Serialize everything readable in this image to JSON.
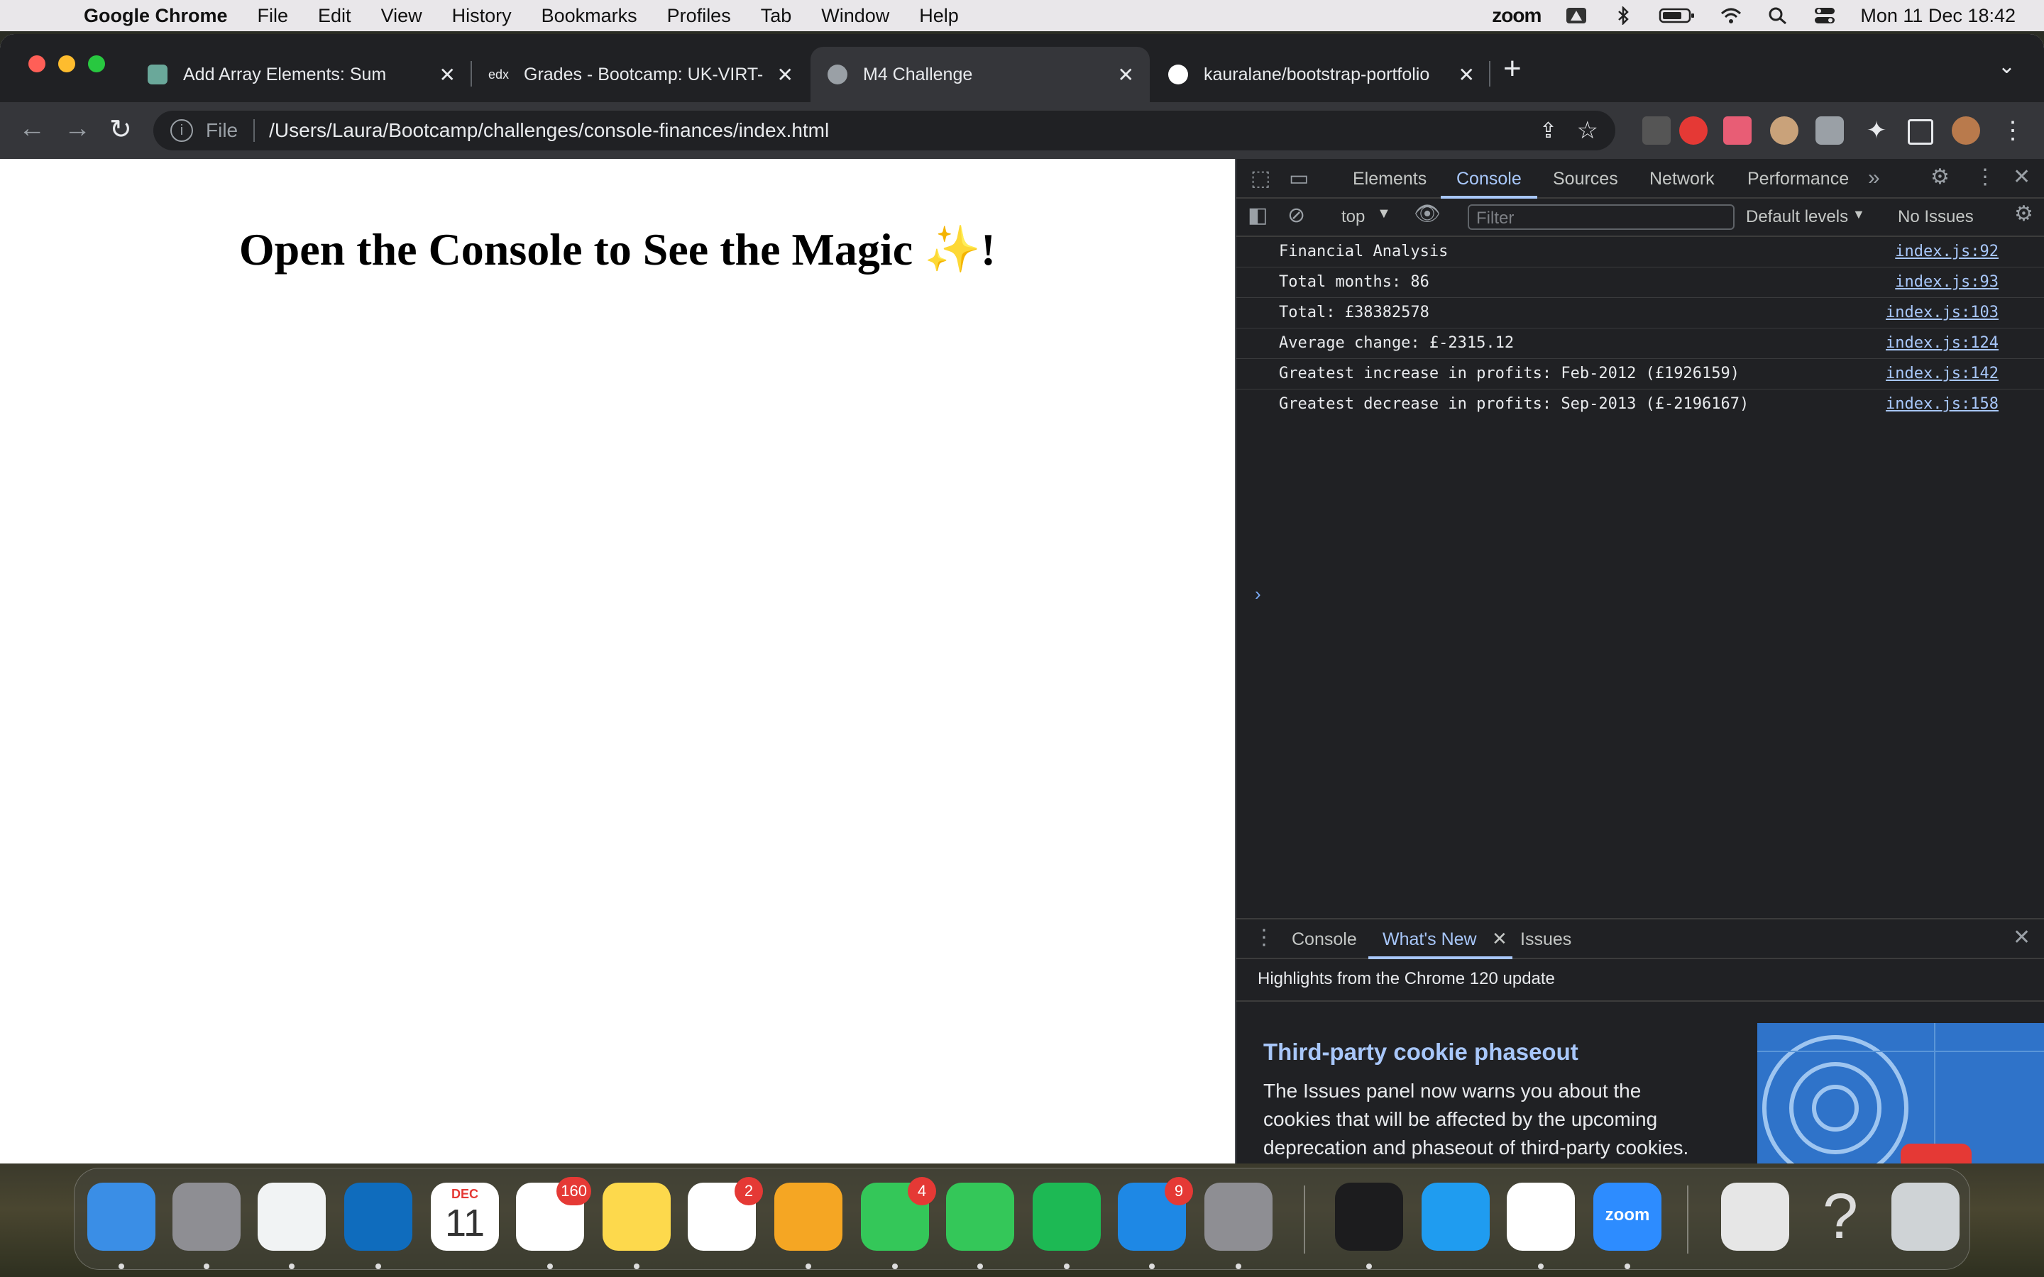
{
  "menubar": {
    "app_name": "Google Chrome",
    "items": [
      "File",
      "Edit",
      "View",
      "History",
      "Bookmarks",
      "Profiles",
      "Tab",
      "Window",
      "Help"
    ],
    "status": {
      "zoom": "zoom",
      "datetime": "Mon 11 Dec  18:42"
    }
  },
  "browser": {
    "tabs": [
      {
        "title": "Add Array Elements: Sum",
        "favicon_color": "#6aa89a",
        "active": false
      },
      {
        "title": "Grades - Bootcamp: UK-VIRT-",
        "favicon_color": "#3c3c3c",
        "active": false
      },
      {
        "title": "M4 Challenge",
        "favicon_color": "#9aa0a6",
        "active": true
      },
      {
        "title": "kauralane/bootstrap-portfolio",
        "favicon_color": "#ffffff",
        "active": false
      }
    ],
    "address": {
      "scheme_label": "File",
      "url": "/Users/Laura/Bootcamp/challenges/console-finances/index.html"
    }
  },
  "page": {
    "heading": "Open the Console to See the Magic ",
    "sparkle": "✨",
    "exclaim": "!"
  },
  "devtools": {
    "tabs": [
      "Elements",
      "Console",
      "Sources",
      "Network",
      "Performance"
    ],
    "active_tab": "Console",
    "toolbar": {
      "context": "top",
      "filter_placeholder": "Filter",
      "levels": "Default levels",
      "issues": "No Issues"
    },
    "logs": [
      {
        "message": "Financial Analysis",
        "source": "index.js:92"
      },
      {
        "message": "Total months: 86",
        "source": "index.js:93"
      },
      {
        "message": "Total: £38382578",
        "source": "index.js:103"
      },
      {
        "message": "Average change: £-2315.12",
        "source": "index.js:124"
      },
      {
        "message": "Greatest increase in profits: Feb-2012 (£1926159)",
        "source": "index.js:142"
      },
      {
        "message": "Greatest decrease in profits: Sep-2013 (£-2196167)",
        "source": "index.js:158"
      }
    ],
    "drawer": {
      "tabs": [
        "Console",
        "What's New",
        "Issues"
      ],
      "active_tab": "What's New",
      "highlight": "Highlights from the Chrome 120 update",
      "feature_title": "Third-party cookie phaseout",
      "feature_body": "The Issues panel now warns you about the cookies that will be affected by the upcoming deprecation and phaseout of third-party cookies."
    }
  },
  "dock": {
    "apps": [
      {
        "name": "Finder",
        "color": "#3a8ee6"
      },
      {
        "name": "Launchpad",
        "color": "#8e8e93"
      },
      {
        "name": "Google Chrome",
        "color": "#f1f3f4"
      },
      {
        "name": "Outlook",
        "color": "#0f6cbd"
      },
      {
        "name": "Calendar",
        "color": "#ffffff",
        "label_month": "DEC",
        "label_day": "11"
      },
      {
        "name": "Reminders",
        "color": "#ffffff",
        "badge": "160"
      },
      {
        "name": "Notes",
        "color": "#fdd94c"
      },
      {
        "name": "Photos",
        "color": "#ffffff",
        "badge": "2"
      },
      {
        "name": "Pages",
        "color": "#f5a623"
      },
      {
        "name": "Messages",
        "color": "#34c759",
        "badge": "4"
      },
      {
        "name": "FaceTime",
        "color": "#34c759"
      },
      {
        "name": "Spotify",
        "color": "#1db954"
      },
      {
        "name": "App Store",
        "color": "#1e88e5",
        "badge": "9"
      },
      {
        "name": "System Settings",
        "color": "#8e8e93"
      },
      {
        "name": "Terminal",
        "color": "#1c1c1e"
      },
      {
        "name": "VS Code",
        "color": "#1f9cf0"
      },
      {
        "name": "Slack",
        "color": "#ffffff"
      },
      {
        "name": "Zoom",
        "color": "#2d8cff",
        "label": "zoom"
      },
      {
        "name": "Preview",
        "color": "#e6e6e6"
      },
      {
        "name": "Help",
        "color": "transparent"
      },
      {
        "name": "Trash",
        "color": "#cfd3d6"
      }
    ]
  }
}
